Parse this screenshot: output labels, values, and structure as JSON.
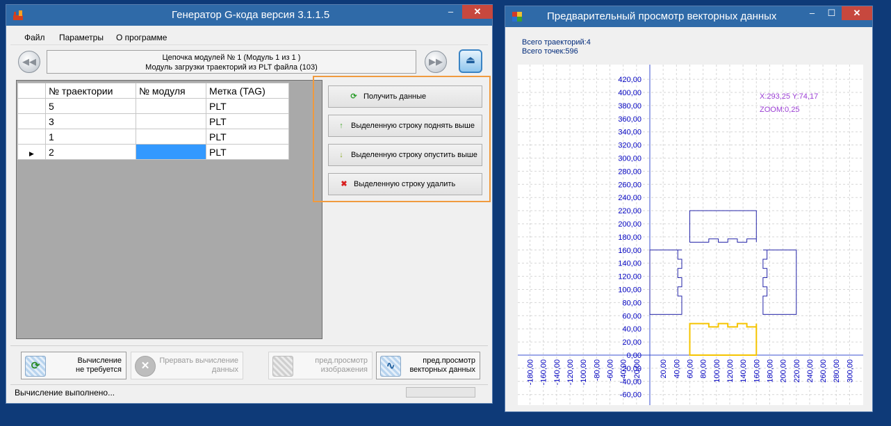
{
  "gen_window": {
    "title": "Генератор G-кода версия 3.1.1.5",
    "controls": {
      "minimize": "–",
      "close": "✕"
    },
    "menu": [
      "Файл",
      "Параметры",
      "О программе"
    ],
    "chain": {
      "line1": "Цепочка модулей № 1 (Модуль 1 из 1 )",
      "line2": "Модуль загрузки траекторий из PLT файла (103)"
    },
    "grid": {
      "columns": [
        "№ траектории",
        "№ модуля",
        "Метка (TAG)"
      ],
      "rows": [
        {
          "traj": "5",
          "module": "",
          "tag": "PLT"
        },
        {
          "traj": "3",
          "module": "",
          "tag": "PLT"
        },
        {
          "traj": "1",
          "module": "",
          "tag": "PLT"
        },
        {
          "traj": "2",
          "module": "",
          "tag": "PLT"
        }
      ]
    },
    "actions": {
      "get_data": "Получить данные",
      "move_up": "Выделенную строку поднять выше",
      "move_down": "Выделенную строку опустить выше",
      "delete_row": "Выделенную строку удалить"
    },
    "bottom": {
      "calc_line1": "Вычисление",
      "calc_line2": "не требуется",
      "abort_line1": "Прервать вычисление",
      "abort_line2": "данных",
      "img_line1": "пред.просмотр",
      "img_line2": "изображения",
      "vec_line1": "пред.просмотр",
      "vec_line2": "векторных данных"
    },
    "status": "Вычисление выполнено..."
  },
  "preview_window": {
    "title": "Предварительный просмотр векторных данных",
    "controls": {
      "minimize": "–",
      "maximize": "☐",
      "close": "✕"
    },
    "traj_count": "Всего траекторий:4",
    "point_count": "Всего точек:596",
    "cursor": "X:293,25 Y:74,17",
    "zoom": "ZOOM:0,25"
  },
  "colors": {
    "shape": "#2424a8",
    "selected_shape": "#f5c400",
    "axis_labels": "#0000c0",
    "readout": "#9b3ed4",
    "highlight": "#f09a3e"
  }
}
